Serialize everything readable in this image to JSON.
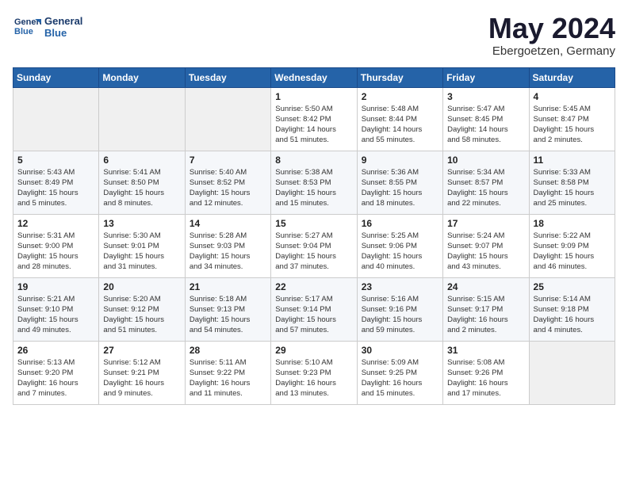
{
  "header": {
    "logo_line1": "General",
    "logo_line2": "Blue",
    "month_year": "May 2024",
    "location": "Ebergoetzen, Germany"
  },
  "days_of_week": [
    "Sunday",
    "Monday",
    "Tuesday",
    "Wednesday",
    "Thursday",
    "Friday",
    "Saturday"
  ],
  "weeks": [
    [
      {
        "day": "",
        "content": ""
      },
      {
        "day": "",
        "content": ""
      },
      {
        "day": "",
        "content": ""
      },
      {
        "day": "1",
        "content": "Sunrise: 5:50 AM\nSunset: 8:42 PM\nDaylight: 14 hours\nand 51 minutes."
      },
      {
        "day": "2",
        "content": "Sunrise: 5:48 AM\nSunset: 8:44 PM\nDaylight: 14 hours\nand 55 minutes."
      },
      {
        "day": "3",
        "content": "Sunrise: 5:47 AM\nSunset: 8:45 PM\nDaylight: 14 hours\nand 58 minutes."
      },
      {
        "day": "4",
        "content": "Sunrise: 5:45 AM\nSunset: 8:47 PM\nDaylight: 15 hours\nand 2 minutes."
      }
    ],
    [
      {
        "day": "5",
        "content": "Sunrise: 5:43 AM\nSunset: 8:49 PM\nDaylight: 15 hours\nand 5 minutes."
      },
      {
        "day": "6",
        "content": "Sunrise: 5:41 AM\nSunset: 8:50 PM\nDaylight: 15 hours\nand 8 minutes."
      },
      {
        "day": "7",
        "content": "Sunrise: 5:40 AM\nSunset: 8:52 PM\nDaylight: 15 hours\nand 12 minutes."
      },
      {
        "day": "8",
        "content": "Sunrise: 5:38 AM\nSunset: 8:53 PM\nDaylight: 15 hours\nand 15 minutes."
      },
      {
        "day": "9",
        "content": "Sunrise: 5:36 AM\nSunset: 8:55 PM\nDaylight: 15 hours\nand 18 minutes."
      },
      {
        "day": "10",
        "content": "Sunrise: 5:34 AM\nSunset: 8:57 PM\nDaylight: 15 hours\nand 22 minutes."
      },
      {
        "day": "11",
        "content": "Sunrise: 5:33 AM\nSunset: 8:58 PM\nDaylight: 15 hours\nand 25 minutes."
      }
    ],
    [
      {
        "day": "12",
        "content": "Sunrise: 5:31 AM\nSunset: 9:00 PM\nDaylight: 15 hours\nand 28 minutes."
      },
      {
        "day": "13",
        "content": "Sunrise: 5:30 AM\nSunset: 9:01 PM\nDaylight: 15 hours\nand 31 minutes."
      },
      {
        "day": "14",
        "content": "Sunrise: 5:28 AM\nSunset: 9:03 PM\nDaylight: 15 hours\nand 34 minutes."
      },
      {
        "day": "15",
        "content": "Sunrise: 5:27 AM\nSunset: 9:04 PM\nDaylight: 15 hours\nand 37 minutes."
      },
      {
        "day": "16",
        "content": "Sunrise: 5:25 AM\nSunset: 9:06 PM\nDaylight: 15 hours\nand 40 minutes."
      },
      {
        "day": "17",
        "content": "Sunrise: 5:24 AM\nSunset: 9:07 PM\nDaylight: 15 hours\nand 43 minutes."
      },
      {
        "day": "18",
        "content": "Sunrise: 5:22 AM\nSunset: 9:09 PM\nDaylight: 15 hours\nand 46 minutes."
      }
    ],
    [
      {
        "day": "19",
        "content": "Sunrise: 5:21 AM\nSunset: 9:10 PM\nDaylight: 15 hours\nand 49 minutes."
      },
      {
        "day": "20",
        "content": "Sunrise: 5:20 AM\nSunset: 9:12 PM\nDaylight: 15 hours\nand 51 minutes."
      },
      {
        "day": "21",
        "content": "Sunrise: 5:18 AM\nSunset: 9:13 PM\nDaylight: 15 hours\nand 54 minutes."
      },
      {
        "day": "22",
        "content": "Sunrise: 5:17 AM\nSunset: 9:14 PM\nDaylight: 15 hours\nand 57 minutes."
      },
      {
        "day": "23",
        "content": "Sunrise: 5:16 AM\nSunset: 9:16 PM\nDaylight: 15 hours\nand 59 minutes."
      },
      {
        "day": "24",
        "content": "Sunrise: 5:15 AM\nSunset: 9:17 PM\nDaylight: 16 hours\nand 2 minutes."
      },
      {
        "day": "25",
        "content": "Sunrise: 5:14 AM\nSunset: 9:18 PM\nDaylight: 16 hours\nand 4 minutes."
      }
    ],
    [
      {
        "day": "26",
        "content": "Sunrise: 5:13 AM\nSunset: 9:20 PM\nDaylight: 16 hours\nand 7 minutes."
      },
      {
        "day": "27",
        "content": "Sunrise: 5:12 AM\nSunset: 9:21 PM\nDaylight: 16 hours\nand 9 minutes."
      },
      {
        "day": "28",
        "content": "Sunrise: 5:11 AM\nSunset: 9:22 PM\nDaylight: 16 hours\nand 11 minutes."
      },
      {
        "day": "29",
        "content": "Sunrise: 5:10 AM\nSunset: 9:23 PM\nDaylight: 16 hours\nand 13 minutes."
      },
      {
        "day": "30",
        "content": "Sunrise: 5:09 AM\nSunset: 9:25 PM\nDaylight: 16 hours\nand 15 minutes."
      },
      {
        "day": "31",
        "content": "Sunrise: 5:08 AM\nSunset: 9:26 PM\nDaylight: 16 hours\nand 17 minutes."
      },
      {
        "day": "",
        "content": ""
      }
    ]
  ]
}
